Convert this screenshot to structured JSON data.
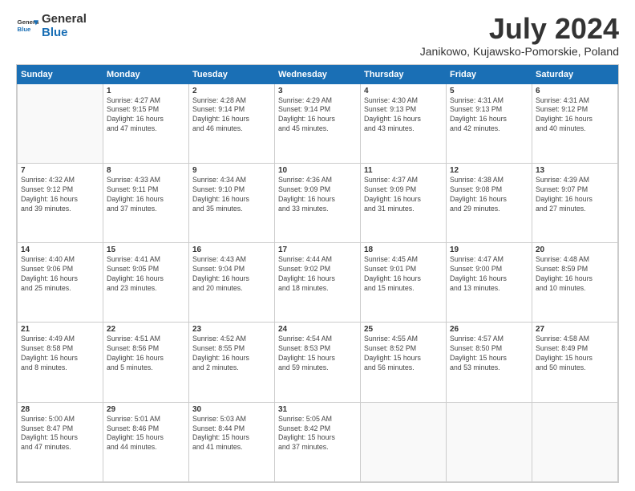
{
  "header": {
    "logo_general": "General",
    "logo_blue": "Blue",
    "title": "July 2024",
    "subtitle": "Janikowo, Kujawsko-Pomorskie, Poland"
  },
  "days_of_week": [
    "Sunday",
    "Monday",
    "Tuesday",
    "Wednesday",
    "Thursday",
    "Friday",
    "Saturday"
  ],
  "weeks": [
    [
      {
        "day": "",
        "info": ""
      },
      {
        "day": "1",
        "info": "Sunrise: 4:27 AM\nSunset: 9:15 PM\nDaylight: 16 hours\nand 47 minutes."
      },
      {
        "day": "2",
        "info": "Sunrise: 4:28 AM\nSunset: 9:14 PM\nDaylight: 16 hours\nand 46 minutes."
      },
      {
        "day": "3",
        "info": "Sunrise: 4:29 AM\nSunset: 9:14 PM\nDaylight: 16 hours\nand 45 minutes."
      },
      {
        "day": "4",
        "info": "Sunrise: 4:30 AM\nSunset: 9:13 PM\nDaylight: 16 hours\nand 43 minutes."
      },
      {
        "day": "5",
        "info": "Sunrise: 4:31 AM\nSunset: 9:13 PM\nDaylight: 16 hours\nand 42 minutes."
      },
      {
        "day": "6",
        "info": "Sunrise: 4:31 AM\nSunset: 9:12 PM\nDaylight: 16 hours\nand 40 minutes."
      }
    ],
    [
      {
        "day": "7",
        "info": "Sunrise: 4:32 AM\nSunset: 9:12 PM\nDaylight: 16 hours\nand 39 minutes."
      },
      {
        "day": "8",
        "info": "Sunrise: 4:33 AM\nSunset: 9:11 PM\nDaylight: 16 hours\nand 37 minutes."
      },
      {
        "day": "9",
        "info": "Sunrise: 4:34 AM\nSunset: 9:10 PM\nDaylight: 16 hours\nand 35 minutes."
      },
      {
        "day": "10",
        "info": "Sunrise: 4:36 AM\nSunset: 9:09 PM\nDaylight: 16 hours\nand 33 minutes."
      },
      {
        "day": "11",
        "info": "Sunrise: 4:37 AM\nSunset: 9:09 PM\nDaylight: 16 hours\nand 31 minutes."
      },
      {
        "day": "12",
        "info": "Sunrise: 4:38 AM\nSunset: 9:08 PM\nDaylight: 16 hours\nand 29 minutes."
      },
      {
        "day": "13",
        "info": "Sunrise: 4:39 AM\nSunset: 9:07 PM\nDaylight: 16 hours\nand 27 minutes."
      }
    ],
    [
      {
        "day": "14",
        "info": "Sunrise: 4:40 AM\nSunset: 9:06 PM\nDaylight: 16 hours\nand 25 minutes."
      },
      {
        "day": "15",
        "info": "Sunrise: 4:41 AM\nSunset: 9:05 PM\nDaylight: 16 hours\nand 23 minutes."
      },
      {
        "day": "16",
        "info": "Sunrise: 4:43 AM\nSunset: 9:04 PM\nDaylight: 16 hours\nand 20 minutes."
      },
      {
        "day": "17",
        "info": "Sunrise: 4:44 AM\nSunset: 9:02 PM\nDaylight: 16 hours\nand 18 minutes."
      },
      {
        "day": "18",
        "info": "Sunrise: 4:45 AM\nSunset: 9:01 PM\nDaylight: 16 hours\nand 15 minutes."
      },
      {
        "day": "19",
        "info": "Sunrise: 4:47 AM\nSunset: 9:00 PM\nDaylight: 16 hours\nand 13 minutes."
      },
      {
        "day": "20",
        "info": "Sunrise: 4:48 AM\nSunset: 8:59 PM\nDaylight: 16 hours\nand 10 minutes."
      }
    ],
    [
      {
        "day": "21",
        "info": "Sunrise: 4:49 AM\nSunset: 8:58 PM\nDaylight: 16 hours\nand 8 minutes."
      },
      {
        "day": "22",
        "info": "Sunrise: 4:51 AM\nSunset: 8:56 PM\nDaylight: 16 hours\nand 5 minutes."
      },
      {
        "day": "23",
        "info": "Sunrise: 4:52 AM\nSunset: 8:55 PM\nDaylight: 16 hours\nand 2 minutes."
      },
      {
        "day": "24",
        "info": "Sunrise: 4:54 AM\nSunset: 8:53 PM\nDaylight: 15 hours\nand 59 minutes."
      },
      {
        "day": "25",
        "info": "Sunrise: 4:55 AM\nSunset: 8:52 PM\nDaylight: 15 hours\nand 56 minutes."
      },
      {
        "day": "26",
        "info": "Sunrise: 4:57 AM\nSunset: 8:50 PM\nDaylight: 15 hours\nand 53 minutes."
      },
      {
        "day": "27",
        "info": "Sunrise: 4:58 AM\nSunset: 8:49 PM\nDaylight: 15 hours\nand 50 minutes."
      }
    ],
    [
      {
        "day": "28",
        "info": "Sunrise: 5:00 AM\nSunset: 8:47 PM\nDaylight: 15 hours\nand 47 minutes."
      },
      {
        "day": "29",
        "info": "Sunrise: 5:01 AM\nSunset: 8:46 PM\nDaylight: 15 hours\nand 44 minutes."
      },
      {
        "day": "30",
        "info": "Sunrise: 5:03 AM\nSunset: 8:44 PM\nDaylight: 15 hours\nand 41 minutes."
      },
      {
        "day": "31",
        "info": "Sunrise: 5:05 AM\nSunset: 8:42 PM\nDaylight: 15 hours\nand 37 minutes."
      },
      {
        "day": "",
        "info": ""
      },
      {
        "day": "",
        "info": ""
      },
      {
        "day": "",
        "info": ""
      }
    ]
  ]
}
